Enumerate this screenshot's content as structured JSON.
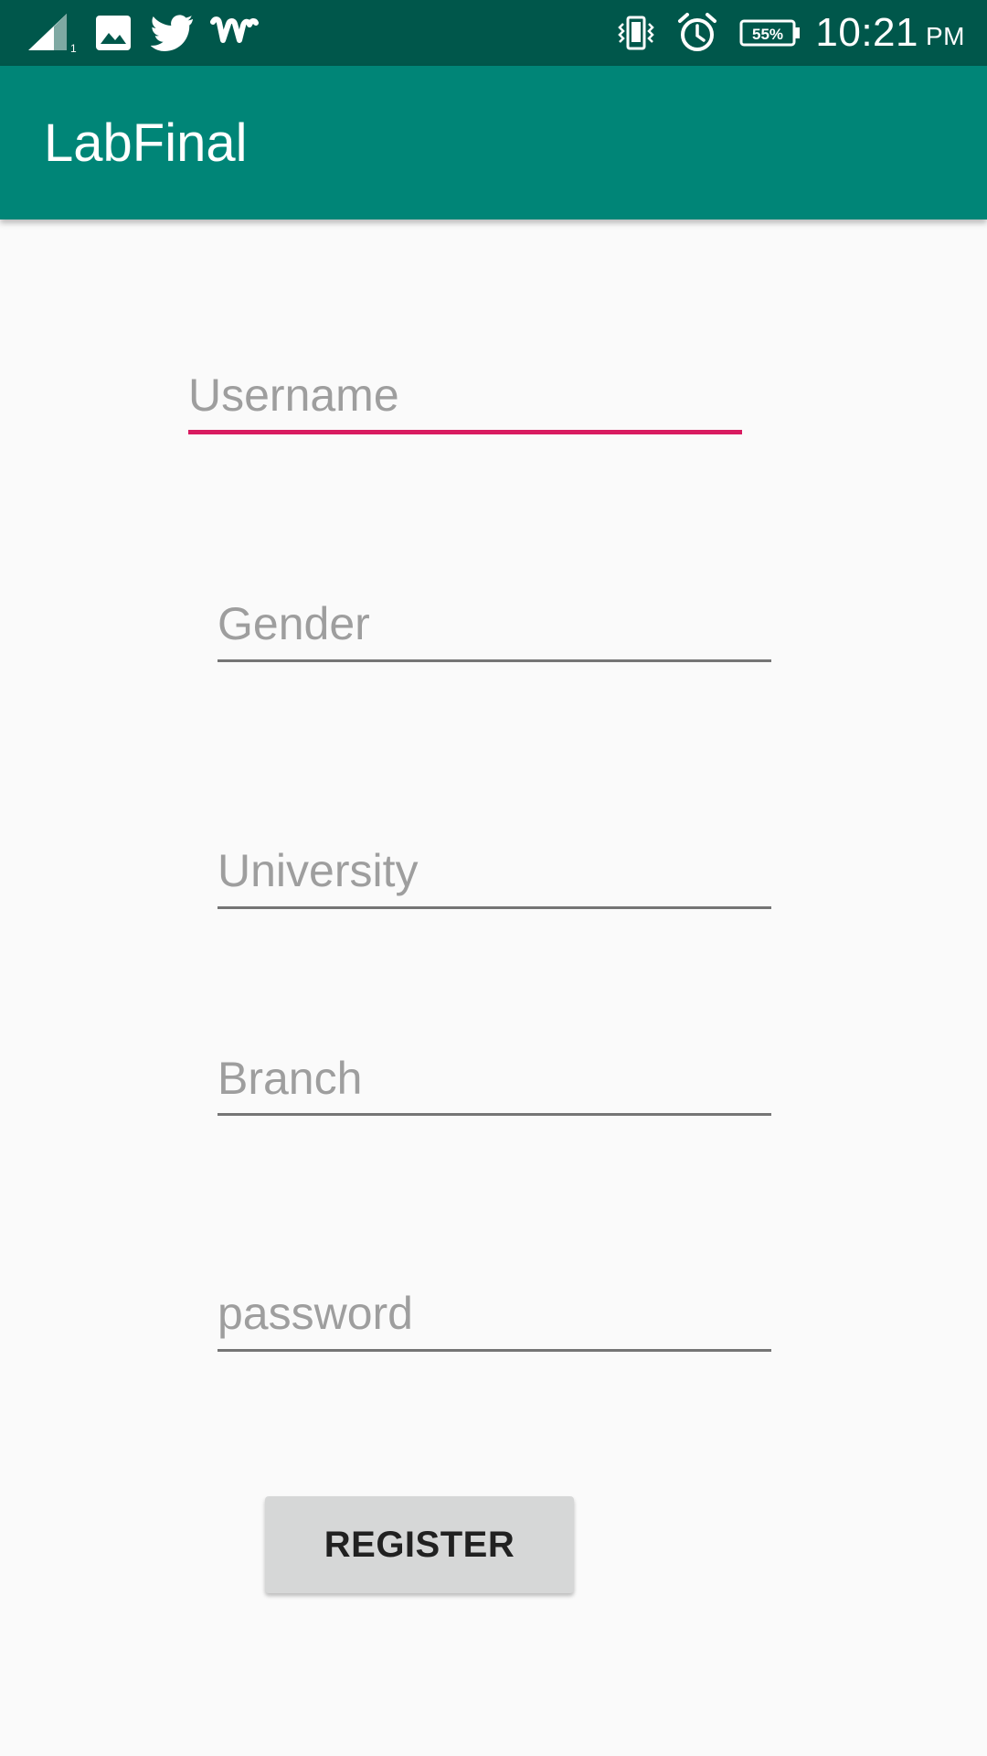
{
  "status_bar": {
    "battery": "55%",
    "time": "10:21",
    "ampm": "PM",
    "icons": [
      "signal-icon",
      "gallery-icon",
      "twitter-icon",
      "wattpad-icon",
      "vibrate-icon",
      "alarm-icon",
      "battery-icon"
    ],
    "background_color": "#00574b"
  },
  "app_bar": {
    "title": "LabFinal",
    "background_color": "#008577"
  },
  "form": {
    "username": {
      "placeholder": "Username",
      "value": "",
      "focused": true
    },
    "gender": {
      "placeholder": "Gender",
      "value": ""
    },
    "university": {
      "placeholder": "University",
      "value": ""
    },
    "branch": {
      "placeholder": "Branch",
      "value": ""
    },
    "password": {
      "placeholder": "password",
      "value": ""
    },
    "register_label": "REGISTER"
  },
  "colors": {
    "accent": "#d81b60",
    "underline": "#757575",
    "hint": "#9e9e9e",
    "button": "#d6d7d7"
  }
}
